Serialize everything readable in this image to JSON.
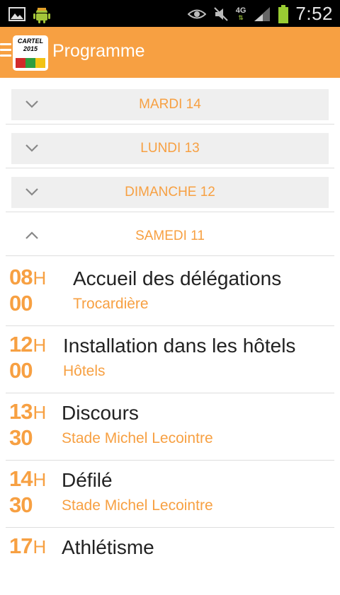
{
  "status_bar": {
    "time": "7:52",
    "network": "4G",
    "left_icons": [
      "image-icon",
      "android-icon"
    ],
    "right_icons": [
      "eye-icon",
      "mute-icon",
      "signal-icon",
      "battery-icon"
    ]
  },
  "app_bar": {
    "title": "Programme",
    "logo_text_line1": "CARTEL",
    "logo_text_line2": "2015",
    "logo_colors": [
      "#d22a2a",
      "#2f9e3f",
      "#f2c313"
    ],
    "accent_color": "#f7a042"
  },
  "days": [
    {
      "label": "MARDI 14",
      "expanded": false
    },
    {
      "label": "LUNDI 13",
      "expanded": false
    },
    {
      "label": "DIMANCHE 12",
      "expanded": false
    },
    {
      "label": "SAMEDI 11",
      "expanded": true
    }
  ],
  "events": [
    {
      "hour": "08",
      "h": "H",
      "minute": "00",
      "title": "Accueil des délégations",
      "place": "Trocardière"
    },
    {
      "hour": "12",
      "h": "H",
      "minute": "00",
      "title": "Installation dans les hôtels",
      "place": "Hôtels"
    },
    {
      "hour": "13",
      "h": "H",
      "minute": "30",
      "title": "Discours",
      "place": "Stade Michel Lecointre"
    },
    {
      "hour": "14",
      "h": "H",
      "minute": "30",
      "title": "Défilé",
      "place": "Stade Michel Lecointre"
    },
    {
      "hour": "17",
      "h": "H",
      "minute": "",
      "title": "Athlétisme",
      "place": ""
    }
  ]
}
